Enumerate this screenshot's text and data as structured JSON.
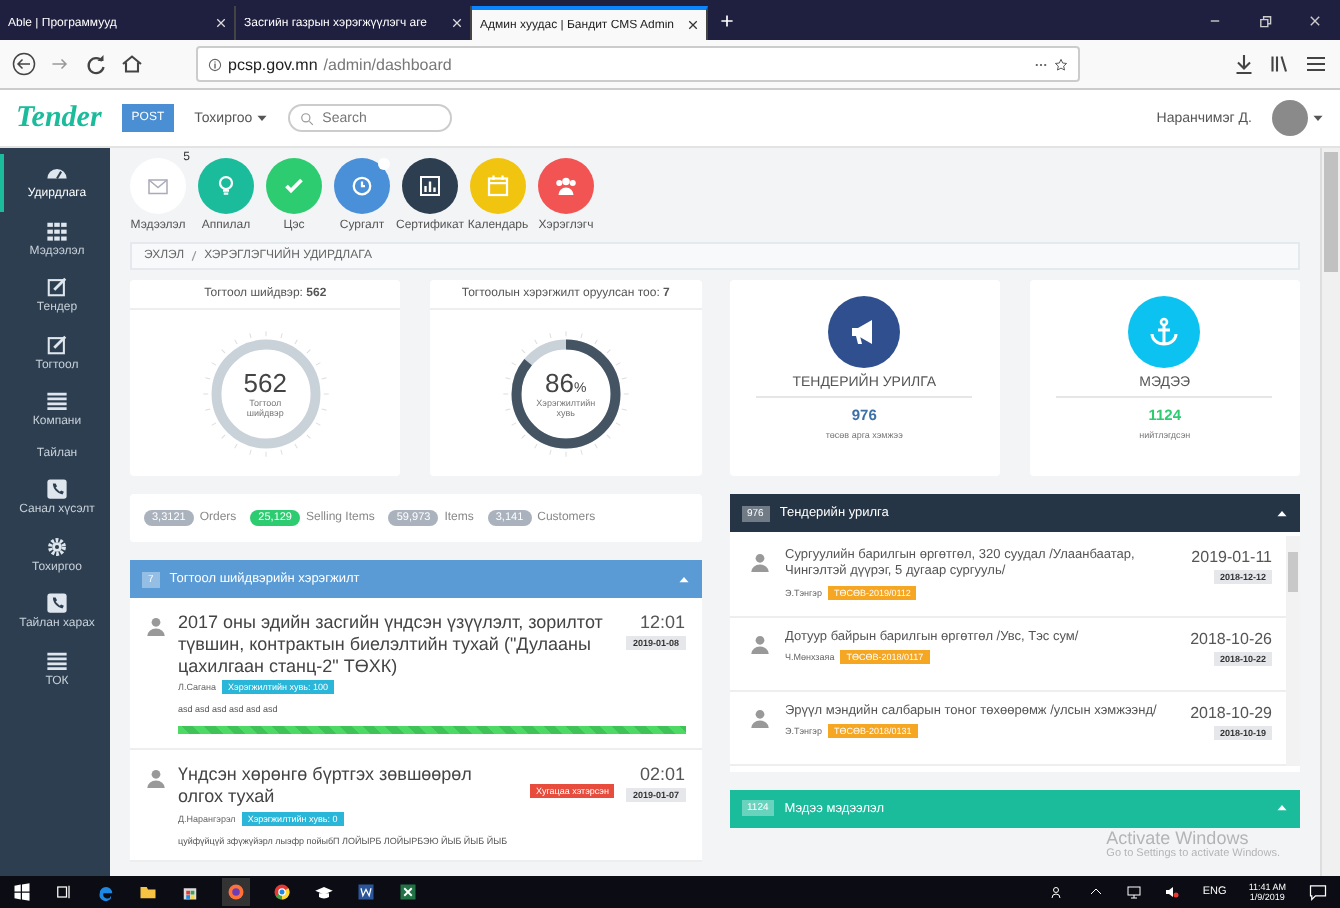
{
  "browser": {
    "tabs": [
      {
        "label": "Able | Программууд",
        "selected": false
      },
      {
        "label": "Засгийн газрын хэрэгжүүлэгч аге",
        "selected": false
      },
      {
        "label": "Админ хуудас | Бандит CMS Admin",
        "selected": true
      }
    ],
    "url_host": "pcsp.gov.mn",
    "url_path": "/admin/dashboard"
  },
  "header": {
    "logo": "Tender",
    "post_button": "POST",
    "settings_menu": "Тохиргоо",
    "search": {
      "placeholder": "Search"
    },
    "user": "Наранчимэг Д."
  },
  "sidebar": {
    "items": [
      {
        "label": "Удирдлага",
        "kind": "dashboard",
        "selected": true
      },
      {
        "label": "Мэдээлэл",
        "kind": "grid",
        "selected": false
      },
      {
        "label": "Тендер",
        "kind": "edit",
        "selected": false
      },
      {
        "label": "Тогтоол",
        "kind": "edit",
        "selected": false
      },
      {
        "label": "Компани",
        "kind": "list",
        "selected": false
      },
      {
        "label": "Тайлан",
        "kind": "none",
        "selected": false
      },
      {
        "label": "Санал хүсэлт",
        "kind": "phone",
        "selected": false
      },
      {
        "label": "Тохиргоо",
        "kind": "gear",
        "selected": false
      },
      {
        "label": "Тайлан харах",
        "kind": "phone",
        "selected": false
      },
      {
        "label": "ТОК",
        "kind": "list",
        "selected": false
      }
    ]
  },
  "shortcuts": [
    {
      "label": "Мэдээлэл",
      "kind": "mail",
      "color": "#ffffff",
      "badge": "5"
    },
    {
      "label": "Аппилал",
      "kind": "bulb",
      "color": "#1abc9c"
    },
    {
      "label": "Цэс",
      "kind": "check",
      "color": "#2ecc71"
    },
    {
      "label": "Сургалт",
      "kind": "clock",
      "color": "#4a90d9",
      "dot": true
    },
    {
      "label": "Сертификат",
      "kind": "chart",
      "color": "#2c3e50"
    },
    {
      "label": "Календарь",
      "kind": "calendar",
      "color": "#f1c40f"
    },
    {
      "label": "Хэрэглэгч",
      "kind": "users",
      "color": "#f25454"
    }
  ],
  "breadcrumb": [
    "ЭХЛЭЛ",
    "ХЭРЭГЛЭГЧИЙН УДИРДЛАГА"
  ],
  "stat_cards": [
    {
      "title": "Тогтоол шийдвэр: **562**",
      "value": "562",
      "caption": "Тогтоол шийдвэр"
    },
    {
      "title": "Тогтоолын хэрэгжилт оруулсан тоо: **7**",
      "value": "86",
      "unit": "%",
      "caption": "Хэрэгжилтийн хувь",
      "level": 0.86
    }
  ],
  "info_cards": [
    {
      "title": "ТЕНДЕРИЙН УРИЛГА",
      "value": "976",
      "caption": "төсөв арга хэмжээ",
      "kind": "megaphone",
      "color": "#2f4f8f"
    },
    {
      "title": "МЭДЭЭ",
      "value": "1124",
      "caption": "нийтлэгдсэн",
      "kind": "anchor",
      "color": "#0cc2f0"
    }
  ],
  "counters": [
    {
      "count": "3,3121",
      "label": "Orders",
      "color": "#aab2bd"
    },
    {
      "count": "25,129",
      "label": "Selling Items",
      "color": "#2ecc71"
    },
    {
      "count": "59,973",
      "label": "Items",
      "color": "#aab2bd"
    },
    {
      "count": "3,141",
      "label": "Customers",
      "color": "#aab2bd"
    }
  ],
  "decisions_panel": {
    "count": "7",
    "title": "Тогтоол шийдвэрийн хэрэгжилт",
    "items": [
      {
        "title": "2017 оны эдийн засгийн үндсэн үзүүлэлт, зорилтот түвшин, контрактын биелэлтийн тухай (\"Дулааны цахилгаан станц-2\" ТӨХК)",
        "author": "Л.Сагана",
        "tag": "Хэрэгжилтийн хувь: 100",
        "time": "12:01",
        "date": "2019-01-08",
        "note": "asd asd asd asd  asd asd",
        "level": 1
      },
      {
        "title": "Үндсэн хөрөнгө бүртгэх зөвшөөрөл олгох тухай",
        "author": "Д.Нарангэрэл",
        "tag": "Хэрэгжилтийн хувь: 0",
        "status": "Хугацаа хэтэрсэн",
        "time": "02:01",
        "date": "2019-01-07",
        "note": "цуйфүйцүй зфүжүйэрл лыэфр пойыбП ЛОЙЫРБ ЛОЙЫРБЭЮ ЙЫБ ЙЫБ ЙЫБ"
      }
    ]
  },
  "tender_panel": {
    "count": "976",
    "title": "Тендерийн урилга",
    "items": [
      {
        "title": "Сургуулийн барилгын өргөтгөл, 320 суудал /Улаанбаатар, Чингэлтэй дүүрэг, 5 дугаар сургууль/",
        "author": "Э.Тэнгэр",
        "tag": "ТӨСӨВ-2019/0112",
        "date": "2019-01-11",
        "posted": "2018-12-12"
      },
      {
        "title": "Дотуур байрын барилгын өргөтгөл /Увс, Тэс сум/",
        "author": "Ч.Мөнхзаяа",
        "tag": "ТӨСӨВ-2018/0117",
        "date": "2018-10-26",
        "posted": "2018-10-22"
      },
      {
        "title": "Эрүүл мэндийн салбарын тоног төхөөрөмж /улсын хэмжээнд/",
        "author": "Э.Тэнгэр",
        "tag": "ТӨСӨВ-2018/0131",
        "date": "2018-10-29",
        "posted": "2018-10-19"
      }
    ]
  },
  "news_panel": {
    "count": "1124",
    "title": "Мэдээ мэдээлэл"
  },
  "os_notice": {
    "title": "Activate Windows",
    "text": "Go to Settings to activate Windows."
  },
  "taskbar": {
    "language": "ENG",
    "time": "11:41 AM",
    "date": "1/9/2019"
  }
}
